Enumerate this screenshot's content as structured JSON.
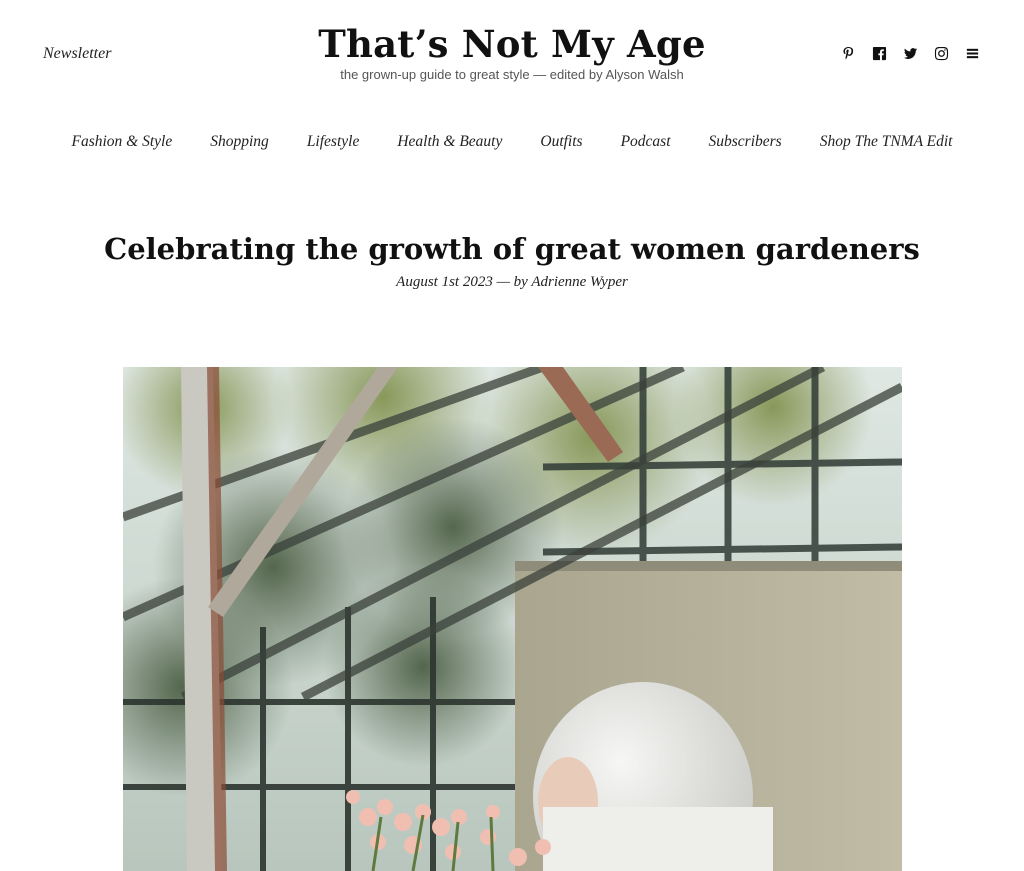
{
  "header": {
    "newsletter_label": "Newsletter",
    "site_title": "That’s Not My Age",
    "tagline": "the grown-up guide to great style — edited by Alyson Walsh",
    "social_icons": [
      "pinterest-icon",
      "facebook-icon",
      "twitter-icon",
      "instagram-icon",
      "menu-icon"
    ]
  },
  "nav": {
    "items": [
      {
        "label": "Fashion & Style"
      },
      {
        "label": "Shopping"
      },
      {
        "label": "Lifestyle"
      },
      {
        "label": "Health & Beauty"
      },
      {
        "label": "Outfits"
      },
      {
        "label": "Podcast"
      },
      {
        "label": "Subscribers"
      },
      {
        "label": "Shop The TNMA Edit"
      }
    ]
  },
  "post": {
    "title": "Celebrating the growth of great women gardeners",
    "meta": "August 1st 2023 — by Adrienne Wyper"
  },
  "colors": {
    "text": "#111111",
    "tagline": "#555555",
    "background": "#ffffff"
  }
}
